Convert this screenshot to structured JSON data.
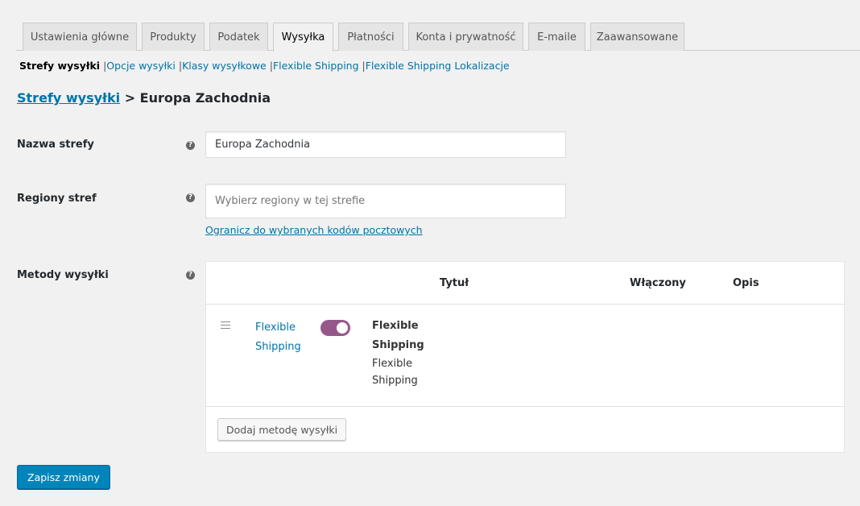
{
  "tabs": [
    {
      "label": "Ustawienia główne",
      "active": false
    },
    {
      "label": "Produkty",
      "active": false
    },
    {
      "label": "Podatek",
      "active": false
    },
    {
      "label": "Wysyłka",
      "active": true
    },
    {
      "label": "Płatności",
      "active": false
    },
    {
      "label": "Konta i prywatność",
      "active": false
    },
    {
      "label": "E-maile",
      "active": false
    },
    {
      "label": "Zaawansowane",
      "active": false
    }
  ],
  "subnav": {
    "current": "Strefy wysyłki",
    "links": [
      "Opcje wysyłki",
      "Klasy wysyłkowe",
      "Flexible Shipping",
      "Flexible Shipping Lokalizacje"
    ],
    "separator": "|"
  },
  "breadcrumb": {
    "parent": "Strefy wysyłki",
    "separator": ">",
    "current": "Europa Zachodnia"
  },
  "form": {
    "zone_name": {
      "label": "Nazwa strefy",
      "value": "Europa Zachodnia"
    },
    "zone_regions": {
      "label": "Regiony stref",
      "placeholder": "Wybierz regiony w tej strefie",
      "limit_link": "Ogranicz do wybranych kodów pocztowych"
    },
    "methods": {
      "label": "Metody wysyłki"
    },
    "help_glyph": "?"
  },
  "methods_table": {
    "headers": {
      "title": "Tytuł",
      "enabled": "Włączony",
      "description": "Opis"
    },
    "rows": [
      {
        "title": "Flexible Shipping",
        "enabled": true,
        "name": "Flexible Shipping",
        "description": "Flexible Shipping"
      }
    ],
    "add_button": "Dodaj metodę wysyłki"
  },
  "save_button": "Zapisz zmiany",
  "colors": {
    "accent": "#0073aa",
    "toggle_on": "#96588a",
    "primary_button": "#0085ba"
  }
}
